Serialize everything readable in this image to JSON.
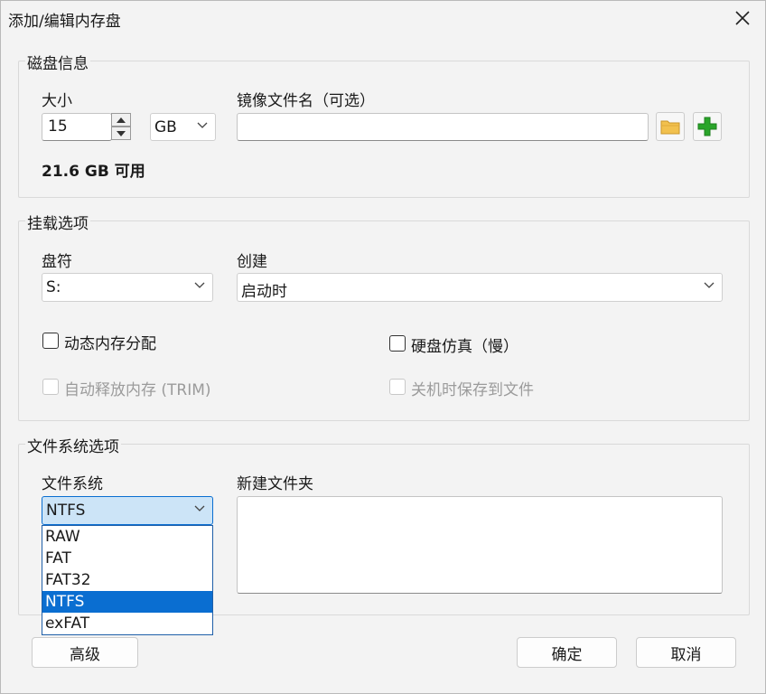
{
  "window": {
    "title": "添加/编辑内存盘"
  },
  "disk_info": {
    "group_title": "磁盘信息",
    "size_label": "大小",
    "size_value": "15",
    "unit_value": "GB",
    "image_label": "镜像文件名（可选）",
    "image_value": "",
    "available_text": "21.6 GB 可用"
  },
  "mount_options": {
    "group_title": "挂载选项",
    "drive_label": "盘符",
    "drive_value": "S:",
    "create_label": "创建",
    "create_value": "启动时",
    "dynamic_memory": "动态内存分配",
    "disk_emulation": "硬盘仿真（慢）",
    "auto_trim": "自动释放内存 (TRIM)",
    "save_on_shutdown": "关机时保存到文件"
  },
  "fs_options": {
    "group_title": "文件系统选项",
    "fs_label": "文件系统",
    "fs_value": "NTFS",
    "folder_label": "新建文件夹",
    "fs_options_list": [
      "RAW",
      "FAT",
      "FAT32",
      "NTFS",
      "exFAT"
    ]
  },
  "buttons": {
    "advanced": "高级",
    "ok": "确定",
    "cancel": "取消"
  },
  "icons": {
    "close": "close-icon",
    "folder": "folder-icon",
    "add": "plus-icon",
    "spin_up": "chevron-up-icon",
    "spin_down": "chevron-down-icon",
    "dropdown": "chevron-down-icon"
  },
  "colors": {
    "selection": "#0a6ed1",
    "plus": "#2aa52a",
    "folder": "#f2c14e"
  }
}
